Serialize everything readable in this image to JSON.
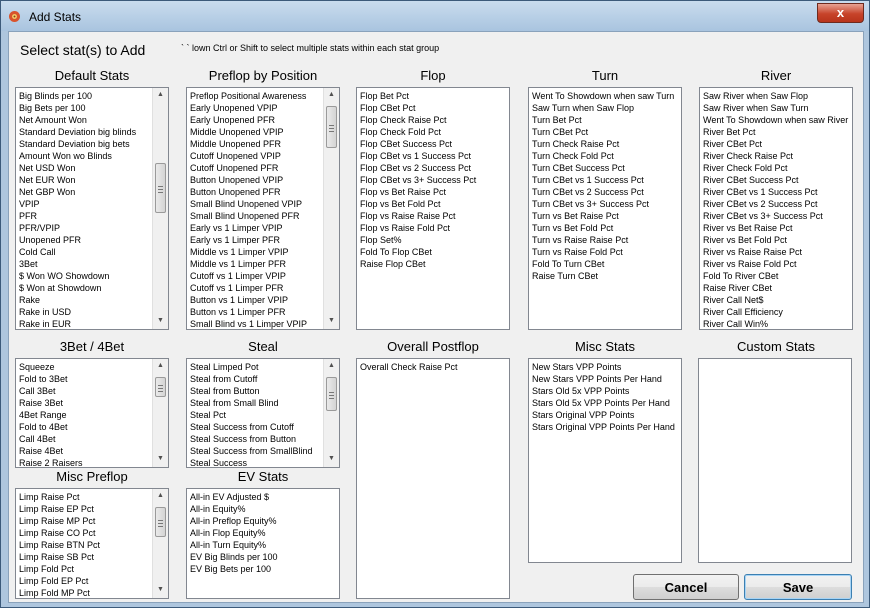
{
  "window": {
    "title": "Add Stats",
    "close_glyph": "x"
  },
  "header": {
    "label": "Select stat(s) to Add",
    "hint": "` ` lown Ctrl or Shift to select multiple stats within each stat group"
  },
  "groups": {
    "default_stats": {
      "label": "Default Stats",
      "items": [
        "Big Blinds per 100",
        "Big Bets per 100",
        "Net Amount Won",
        "Standard Deviation big blinds",
        "Standard Deviation big bets",
        "Amount Won wo Blinds",
        "Net USD Won",
        "Net EUR Won",
        "Net GBP Won",
        "VPIP",
        "PFR",
        "PFR/VPIP",
        "Unopened PFR",
        "Cold Call",
        "3Bet",
        "$ Won WO Showdown",
        "$ Won at Showdown",
        "Rake",
        "Rake in USD",
        "Rake in EUR"
      ]
    },
    "preflop_by_position": {
      "label": "Preflop by Position",
      "items": [
        "Preflop Positional Awareness",
        "Early Unopened VPIP",
        "Early Unopened PFR",
        "Middle Unopened VPIP",
        "Middle Unopened PFR",
        "Cutoff Unopened VPIP",
        "Cutoff Unopened PFR",
        "Button Unopened VPIP",
        "Button Unopened PFR",
        "Small Blind Unopened VPIP",
        "Small Blind Unopened PFR",
        "Early vs 1 Limper VPIP",
        "Early vs 1 Limper PFR",
        "Middle vs 1 Limper VPIP",
        "Middle vs 1 Limper PFR",
        "Cutoff vs 1 Limper VPIP",
        "Cutoff vs 1 Limper PFR",
        "Button vs 1 Limper VPIP",
        "Button vs 1 Limper PFR",
        "Small Blind vs 1 Limper VPIP"
      ]
    },
    "flop": {
      "label": "Flop",
      "items": [
        "Flop Bet Pct",
        "Flop CBet Pct",
        "Flop Check Raise Pct",
        "Flop Check Fold Pct",
        "Flop CBet Success Pct",
        "Flop CBet vs 1 Success Pct",
        "Flop CBet vs 2 Success Pct",
        "Flop CBet vs 3+ Success Pct",
        "Flop vs Bet Raise Pct",
        "Flop vs Bet Fold Pct",
        "Flop vs Raise Raise Pct",
        "Flop vs Raise Fold Pct",
        "Flop Set%",
        "Fold To Flop CBet",
        "Raise Flop CBet"
      ]
    },
    "turn": {
      "label": "Turn",
      "items": [
        "Went To Showdown when saw Turn",
        "Saw Turn when Saw Flop",
        "Turn Bet Pct",
        "Turn CBet Pct",
        "Turn Check Raise Pct",
        "Turn Check Fold Pct",
        "Turn CBet Success Pct",
        "Turn CBet vs 1 Success Pct",
        "Turn CBet vs 2 Success Pct",
        "Turn CBet vs 3+ Success Pct",
        "Turn vs Bet Raise Pct",
        "Turn vs Bet Fold Pct",
        "Turn vs Raise Raise Pct",
        "Turn vs Raise Fold Pct",
        "Fold To Turn CBet",
        "Raise Turn CBet"
      ]
    },
    "river": {
      "label": "River",
      "items": [
        "Saw River when Saw Flop",
        "Saw River when Saw Turn",
        "Went To Showdown when saw River",
        "River Bet Pct",
        "River CBet Pct",
        "River Check Raise Pct",
        "River Check Fold Pct",
        "River CBet Success Pct",
        "River CBet vs 1 Success Pct",
        "River CBet vs 2 Success Pct",
        "River CBet vs 3+ Success Pct",
        "River vs Bet Raise Pct",
        "River vs Bet Fold Pct",
        "River vs Raise Raise Pct",
        "River vs Raise Fold Pct",
        "Fold To River CBet",
        "Raise River CBet",
        "River Call Net$",
        "River Call Efficiency",
        "River Call Win%"
      ]
    },
    "three_four_bet": {
      "label": "3Bet / 4Bet",
      "items": [
        "Squeeze",
        "Fold to 3Bet",
        "Call 3Bet",
        "Raise 3Bet",
        "4Bet Range",
        "Fold to 4Bet",
        "Call 4Bet",
        "Raise 4Bet",
        "Raise 2 Raisers"
      ]
    },
    "steal": {
      "label": "Steal",
      "items": [
        "Steal Limped Pot",
        "Steal from Cutoff",
        "Steal from Button",
        "Steal from Small Blind",
        "Steal Pct",
        "Steal Success from Cutoff",
        "Steal Success from Button",
        "Steal Success from SmallBlind",
        "Steal Success"
      ]
    },
    "overall_postflop": {
      "label": "Overall Postflop",
      "items": [
        "Overall Check Raise Pct"
      ]
    },
    "misc_stats": {
      "label": "Misc Stats",
      "items": [
        "New Stars VPP Points",
        "New Stars VPP Points Per Hand",
        "Stars Old 5x VPP Points",
        "Stars Old 5x VPP Points Per Hand",
        "Stars Original VPP Points",
        "Stars Original VPP Points Per Hand"
      ]
    },
    "custom_stats": {
      "label": "Custom Stats",
      "items": []
    },
    "misc_preflop": {
      "label": "Misc Preflop",
      "items": [
        "Limp Raise Pct",
        "Limp Raise EP Pct",
        "Limp Raise MP Pct",
        "Limp Raise CO Pct",
        "Limp Raise BTN Pct",
        "Limp Raise SB Pct",
        "Limp Fold Pct",
        "Limp Fold EP Pct",
        "Limp Fold MP Pct"
      ]
    },
    "ev_stats": {
      "label": "EV Stats",
      "items": [
        "All-in EV Adjusted $",
        "All-in Equity%",
        "All-in Preflop Equity%",
        "All-in Flop Equity%",
        "All-in Turn Equity%",
        "EV Big Blinds per 100",
        "EV Big Bets per 100"
      ]
    }
  },
  "buttons": {
    "cancel": "Cancel",
    "save": "Save"
  },
  "colors": {
    "window_frame": "#aec6de",
    "close_button": "#c7432a",
    "client_bg": "#f0f0f0"
  },
  "icons": {
    "app": "gear-flower-icon",
    "scroll_up": "scroll-up-arrow-icon",
    "scroll_down": "scroll-down-arrow-icon"
  }
}
